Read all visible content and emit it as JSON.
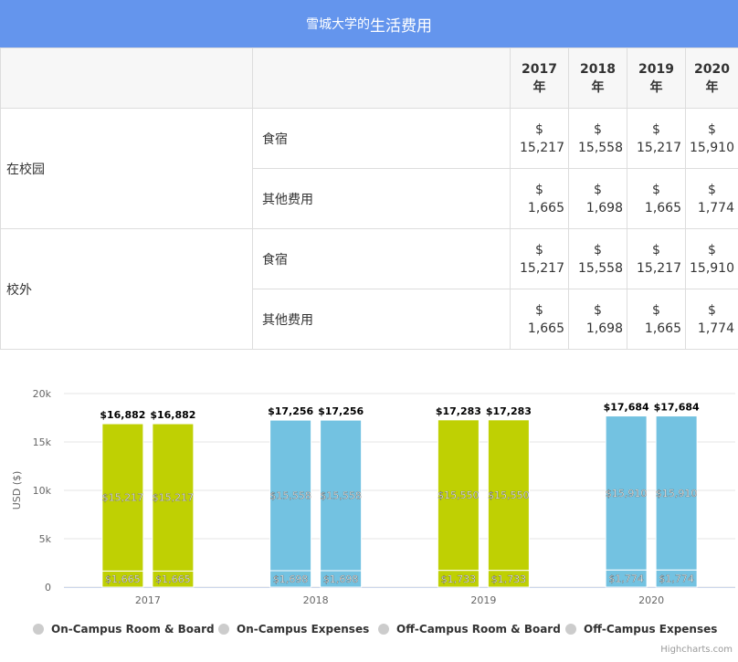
{
  "header": {
    "title_prefix": "雪城大学的",
    "title_main": "生活费用"
  },
  "table": {
    "years": [
      {
        "year": "2017",
        "unit": "年"
      },
      {
        "year": "2018",
        "unit": "年"
      },
      {
        "year": "2019",
        "unit": "年"
      },
      {
        "year": "2020",
        "unit": "年"
      }
    ],
    "currency": "$",
    "groups": [
      {
        "label": "在校园",
        "rows": [
          {
            "label": "食宿",
            "values": [
              "15,217",
              "15,558",
              "15,217",
              "15,910"
            ]
          },
          {
            "label": "其他费用",
            "values": [
              "1,665",
              "1,698",
              "1,665",
              "1,774"
            ]
          }
        ]
      },
      {
        "label": "校外",
        "rows": [
          {
            "label": "食宿",
            "values": [
              "15,217",
              "15,558",
              "15,217",
              "15,910"
            ]
          },
          {
            "label": "其他费用",
            "values": [
              "1,665",
              "1,698",
              "1,665",
              "1,774"
            ]
          }
        ]
      }
    ]
  },
  "chart_data": {
    "type": "bar",
    "stacked": true,
    "categories": [
      "2017",
      "2018",
      "2019",
      "2020"
    ],
    "ylabel": "USD ($)",
    "ylim": [
      0,
      20000
    ],
    "yticks": [
      "0",
      "5k",
      "10k",
      "15k",
      "20k"
    ],
    "ytick_values": [
      0,
      5000,
      10000,
      15000,
      20000
    ],
    "series": [
      {
        "name": "On-Campus Room & Board",
        "stack": "on",
        "values": [
          15217,
          15558,
          15550,
          15910
        ],
        "labels": [
          "$15,217",
          "$15,558",
          "$15,550",
          "$15,910"
        ]
      },
      {
        "name": "On-Campus Expenses",
        "stack": "on",
        "values": [
          1665,
          1698,
          1733,
          1774
        ],
        "labels": [
          "$1,665",
          "$1,698",
          "$1,733",
          "$1,774"
        ]
      },
      {
        "name": "Off-Campus Room & Board",
        "stack": "off",
        "values": [
          15217,
          15558,
          15550,
          15910
        ],
        "labels": [
          "$15,217",
          "$15,558",
          "$15,550",
          "$15,910"
        ]
      },
      {
        "name": "Off-Campus Expenses",
        "stack": "off",
        "values": [
          1665,
          1698,
          1733,
          1774
        ],
        "labels": [
          "$1,665",
          "$1,698",
          "$1,733",
          "$1,774"
        ]
      }
    ],
    "totals": [
      "$16,882",
      "$17,256",
      "$17,283",
      "$17,684"
    ],
    "category_colors": [
      "#bfd003",
      "#73c2e1",
      "#bfd003",
      "#73c2e1"
    ],
    "legend_marker_color": "#cccccc",
    "grid": true,
    "legend_position": "bottom"
  },
  "credits": "Highcharts.com"
}
